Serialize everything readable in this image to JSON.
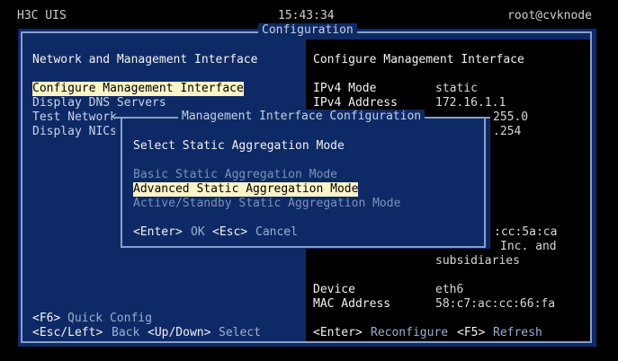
{
  "status_bar": {
    "left": "H3C UIS",
    "clock": "15:43:34",
    "user": "root@cvknode"
  },
  "frame_title": "Configuration",
  "left_panel": {
    "heading": "Network and Management Interface",
    "menu": [
      "Configure Management Interface",
      "Display DNS Servers",
      "Test Network",
      "Display NICs"
    ],
    "hints": {
      "quick_key": "<F6>",
      "quick_label": "Quick Config",
      "back_key": "<Esc/Left>",
      "back_label": "Back",
      "select_key": "<Up/Down>",
      "select_label": "Select"
    }
  },
  "right_panel": {
    "heading": "Configure Management Interface",
    "ipv4_mode_label": "IPv4 Mode",
    "ipv4_mode_value": "static",
    "ipv4_address_label": "IPv4 Address",
    "ipv4_address_value": "172.16.1.1",
    "netmask_partial": "255.0",
    "gateway_partial": ".254",
    "mac_partial": ":cc:5a:ca",
    "vendor_line1": "Inc. and",
    "vendor_line2": "subsidiaries",
    "device_label": "Device",
    "device_value": "eth6",
    "mac_label": "MAC Address",
    "mac_value": "58:c7:ac:cc:66:fa",
    "hints": {
      "reconfigure_key": "<Enter>",
      "reconfigure_label": "Reconfigure",
      "refresh_key": "<F5>",
      "refresh_label": "Refresh"
    }
  },
  "dialog": {
    "title": "Management Interface Configuration",
    "heading": "Select Static Aggregation Mode",
    "options": [
      "Basic Static Aggregation Mode",
      "Advanced Static Aggregation Mode",
      "Active/Standby Static Aggregation Mode"
    ],
    "ok_key": "<Enter>",
    "ok_label": "OK",
    "cancel_key": "<Esc>",
    "cancel_label": "Cancel"
  }
}
